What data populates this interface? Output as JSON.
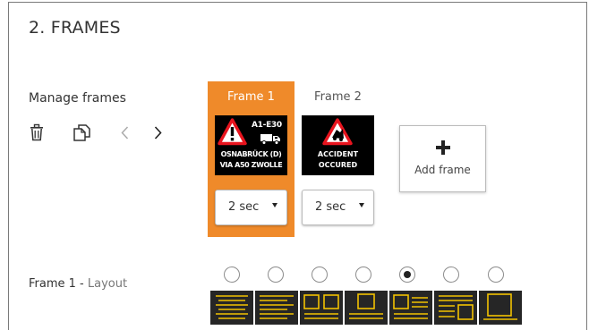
{
  "section": {
    "title": "2. FRAMES"
  },
  "manage": {
    "label": "Manage frames"
  },
  "frames": [
    {
      "tab": "Frame 1",
      "selected": true,
      "thumb": {
        "code": "A1-E30",
        "line1": "OSNABRÜCK (D)",
        "line2": "VIA A50 ZWOLLE"
      },
      "duration": "2 sec"
    },
    {
      "tab": "Frame 2",
      "selected": false,
      "thumb": {
        "line1": "ACCIDENT",
        "line2": "OCCURED"
      },
      "duration": "2 sec"
    }
  ],
  "add_frame": {
    "label": "Add frame"
  },
  "layout": {
    "label_prefix": "Frame 1 -",
    "label_suffix": "Layout",
    "selected_index": 4,
    "options": [
      "layout-1",
      "layout-2",
      "layout-3",
      "layout-4",
      "layout-5",
      "layout-6",
      "layout-7"
    ]
  },
  "colors": {
    "accent": "#ef8a2a",
    "layout_tile_bg": "#262626",
    "layout_line": "#f2c200",
    "warning_red": "#e8141e"
  }
}
